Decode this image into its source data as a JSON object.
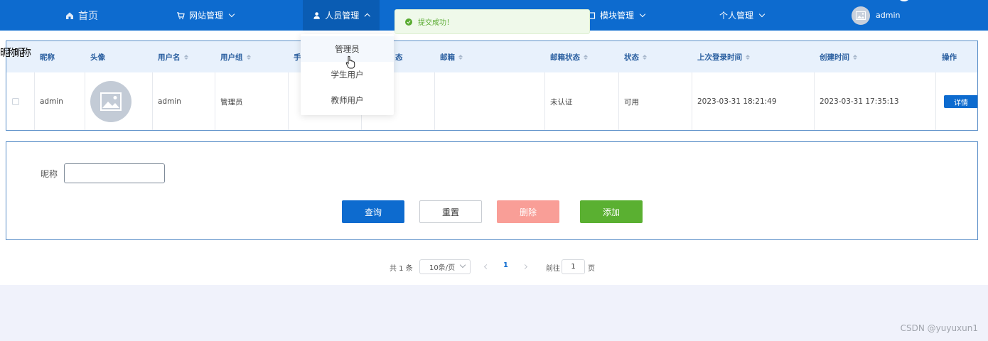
{
  "nav": {
    "home": "首页",
    "website_mgmt": "网站管理",
    "people_mgmt": "人员管理",
    "module_mgmt": "模块管理",
    "personal_mgmt": "个人管理",
    "user": "admin"
  },
  "dropdown": {
    "items": [
      "管理员",
      "学生用户",
      "教师用户"
    ]
  },
  "toast": {
    "message": "提交成功！"
  },
  "partial_text": "昵称",
  "table": {
    "headers": {
      "nickname": "昵称",
      "avatar": "头像",
      "username": "用户名",
      "group": "用户组",
      "phone_partial": "手",
      "state_partial": "态",
      "email": "邮箱",
      "email_status": "邮箱状态",
      "status": "状态",
      "last_login": "上次登录时间",
      "created": "创建时间",
      "actions": "操作"
    },
    "row": {
      "nickname": "admin",
      "username": "admin",
      "group": "管理员",
      "email_status": "未认证",
      "status": "可用",
      "last_login": "2023-03-31 18:21:49",
      "created": "2023-03-31 17:35:13",
      "detail": "详情"
    }
  },
  "search": {
    "label": "昵称",
    "value": "",
    "buttons": {
      "query": "查询",
      "reset": "重置",
      "delete": "删除",
      "add": "添加"
    }
  },
  "pager": {
    "total": "共 1 条",
    "size": "10条/页",
    "current": "1",
    "goto": "前往",
    "goto_value": "1",
    "page_unit": "页"
  },
  "watermark": "CSDN @yuyuxun1",
  "colors": {
    "primary": "#0d6bcf",
    "danger_light": "#f99e97",
    "success": "#5ab031",
    "toast_text": "#59ab31"
  }
}
